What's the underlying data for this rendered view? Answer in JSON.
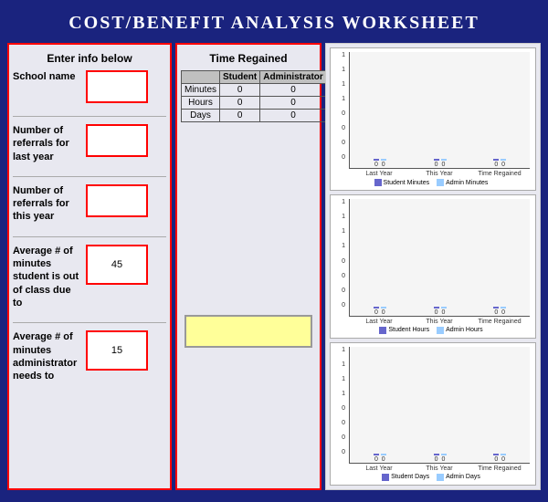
{
  "title": "COST/BENEFIT ANALYSIS WORKSHEET",
  "leftPanel": {
    "header": "Enter info below",
    "fields": [
      {
        "label": "School name",
        "value": "",
        "id": "school-name"
      },
      {
        "label": "Number of referrals for last year",
        "value": "",
        "id": "referrals-last"
      },
      {
        "label": "Number of referrals for this year",
        "value": "",
        "id": "referrals-this"
      },
      {
        "label": "Average # of minutes student is out of class due to",
        "value": "45",
        "id": "avg-minutes-student"
      },
      {
        "label": "Average # of minutes administrator needs to",
        "value": "15",
        "id": "avg-minutes-admin"
      }
    ]
  },
  "middlePanel": {
    "header": "Time Regained",
    "tableHeaders": [
      "",
      "Student",
      "Administrator"
    ],
    "tableRows": [
      {
        "label": "Minutes",
        "student": "0",
        "admin": "0"
      },
      {
        "label": "Hours",
        "student": "0",
        "admin": "0"
      },
      {
        "label": "Days",
        "student": "0",
        "admin": "0"
      }
    ]
  },
  "charts": [
    {
      "id": "minutes-chart",
      "yLabels": [
        "1",
        "1",
        "1",
        "1",
        "0",
        "0",
        "0",
        "0"
      ],
      "groups": [
        {
          "label": "Last Year",
          "studentVal": 0,
          "adminVal": 0
        },
        {
          "label": "This Year",
          "studentVal": 0,
          "adminVal": 0
        },
        {
          "label": "Time Regained",
          "studentVal": 0,
          "adminVal": 0
        }
      ],
      "legend": [
        "Student Minutes",
        "Admin Minutes"
      ]
    },
    {
      "id": "hours-chart",
      "yLabels": [
        "1",
        "1",
        "1",
        "1",
        "0",
        "0",
        "0",
        "0"
      ],
      "groups": [
        {
          "label": "Last Year",
          "studentVal": 0,
          "adminVal": 0
        },
        {
          "label": "This Year",
          "studentVal": 0,
          "adminVal": 0
        },
        {
          "label": "Time Regained",
          "studentVal": 0,
          "adminVal": 0
        }
      ],
      "legend": [
        "Student Hours",
        "Admin Hours"
      ]
    },
    {
      "id": "days-chart",
      "yLabels": [
        "1",
        "1",
        "1",
        "1",
        "0",
        "0",
        "0",
        "0"
      ],
      "groups": [
        {
          "label": "Last Year",
          "studentVal": 0,
          "adminVal": 0
        },
        {
          "label": "This Year",
          "studentVal": 0,
          "adminVal": 0
        },
        {
          "label": "Time Regained",
          "studentVal": 0,
          "adminVal": 0
        }
      ],
      "legend": [
        "Student Days",
        "Admin Days"
      ]
    }
  ]
}
